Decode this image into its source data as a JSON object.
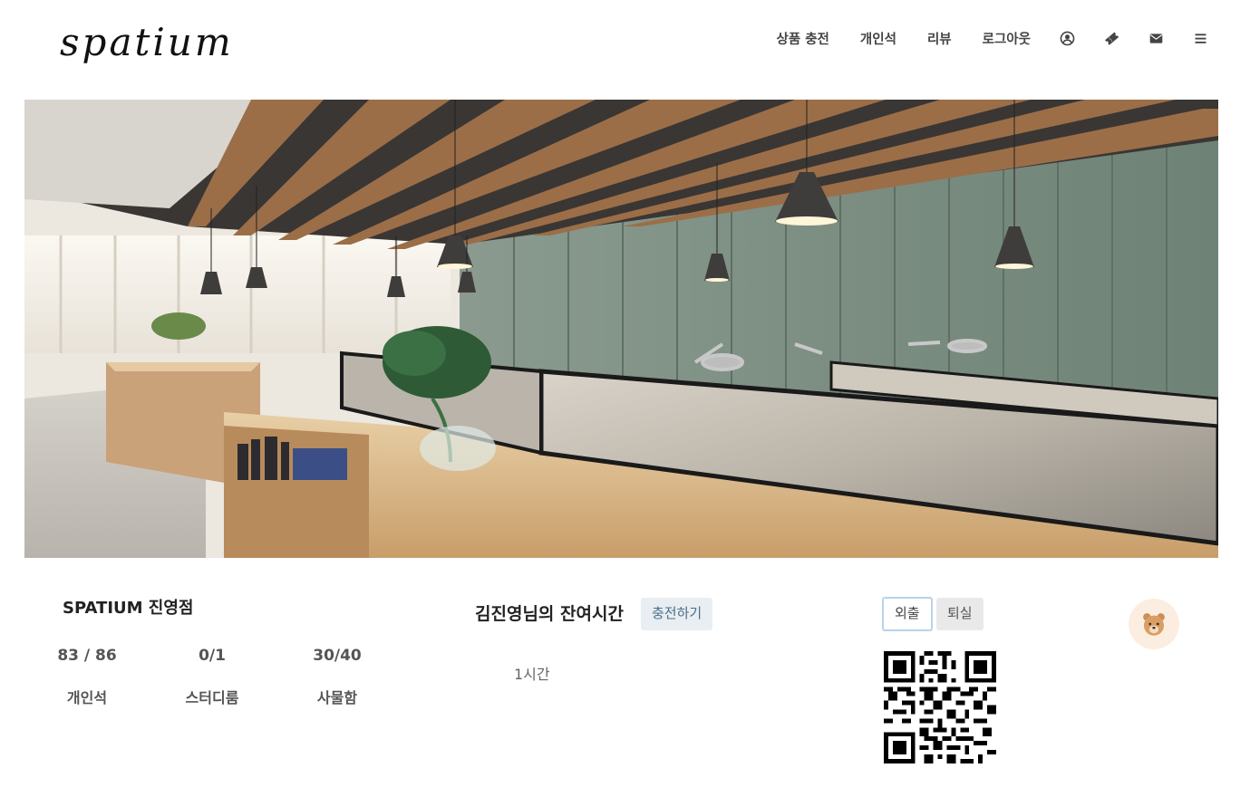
{
  "header": {
    "logo_text": "spatium",
    "nav": {
      "charge_label": "상품 충전",
      "seat_label": "개인석",
      "review_label": "리뷰",
      "logout_label": "로그아웃"
    },
    "icons": [
      "user-circle-icon",
      "ticket-icon",
      "envelope-icon",
      "menu-icon"
    ]
  },
  "store": {
    "name": "SPATIUM 진영점",
    "stats": [
      {
        "value": "83 / 86",
        "label": "개인석"
      },
      {
        "value": "0/1",
        "label": "스터디룸"
      },
      {
        "value": "30/40",
        "label": "사물함"
      }
    ]
  },
  "remaining": {
    "title": "김진영님의 잔여시간",
    "charge_button": "충전하기",
    "value": "1시간"
  },
  "actions": {
    "out_button": "외출",
    "leave_button": "퇴실"
  },
  "colors": {
    "accent_blue": "#4a6e8a",
    "button_bg": "#e9eef2",
    "avatar_bg": "#fbeee0"
  }
}
